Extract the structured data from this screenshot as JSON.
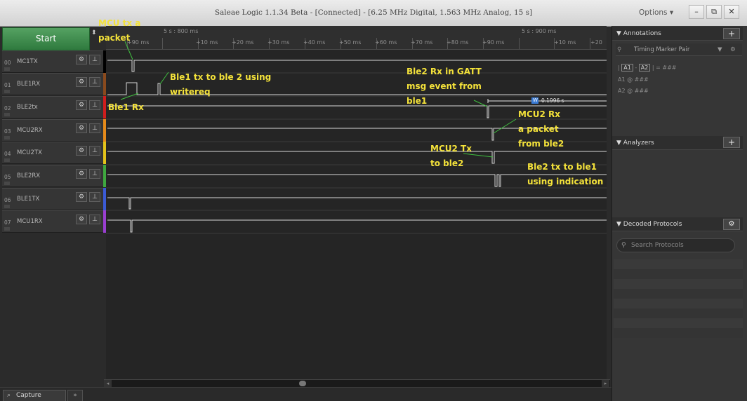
{
  "window": {
    "title": "Saleae Logic 1.1.34 Beta - [Connected] - [6.25 MHz Digital, 1.563 MHz Analog, 15 s]",
    "options_label": "Options ▾",
    "minimize": "–",
    "restore": "⧉",
    "close": "✕"
  },
  "start_label": "Start",
  "spinner_glyph": "⬍",
  "channels": [
    {
      "num": "00",
      "name": "MC1TX",
      "color": "#000000"
    },
    {
      "num": "01",
      "name": "BLE1RX",
      "color": "#8a4a1d"
    },
    {
      "num": "02",
      "name": "BLE2tx",
      "color": "#d11d1d"
    },
    {
      "num": "03",
      "name": "MCU2RX",
      "color": "#e58a1a"
    },
    {
      "num": "04",
      "name": "MCU2TX",
      "color": "#e3c21a"
    },
    {
      "num": "05",
      "name": "BLE2RX",
      "color": "#3fa83f"
    },
    {
      "num": "06",
      "name": "BLE1TX",
      "color": "#3b5bd6"
    },
    {
      "num": "07",
      "name": "MCU1RX",
      "color": "#9a3fd1"
    }
  ],
  "ruler": {
    "head_left": "5 s : 800 ms",
    "head_right": "5 s : 900 ms",
    "ticks": [
      "+90 ms",
      "+10 ms",
      "+20 ms",
      "+30 ms",
      "+40 ms",
      "+50 ms",
      "+60 ms",
      "+70 ms",
      "+80 ms",
      "+90 ms",
      "+10 ms",
      "+20"
    ]
  },
  "cursor": {
    "badge": "W",
    "value": "0.1996 s"
  },
  "annotations": [
    {
      "lines": [
        "MCU tx a",
        "packet"
      ]
    },
    {
      "lines": [
        "Ble1 tx to ble 2 using",
        "writereq"
      ]
    },
    {
      "lines": [
        "Ble1 Rx"
      ]
    },
    {
      "lines": [
        "Ble2 Rx in GATT",
        "msg event from",
        "ble1"
      ]
    },
    {
      "lines": [
        "MCU2 Rx",
        "a packet",
        "from ble2"
      ]
    },
    {
      "lines": [
        "MCU2 Tx",
        "to ble2"
      ]
    },
    {
      "lines": [
        "Ble2 tx to  ble1",
        "using indication"
      ]
    }
  ],
  "right_panel": {
    "annotations_title": "Annotations",
    "timing_marker": "Timing Marker Pair",
    "ann_a1": "A1",
    "ann_a2": "A2",
    "ann_formula": "| = ###",
    "ann_a1_line": "A1  @  ###",
    "ann_a2_line": "A2  @  ###",
    "analyzers_title": "Analyzers",
    "decoded_title": "Decoded Protocols",
    "search_placeholder": "Search Protocols"
  },
  "bottom": {
    "capture_tab": "Capture",
    "more_tab": "»"
  }
}
